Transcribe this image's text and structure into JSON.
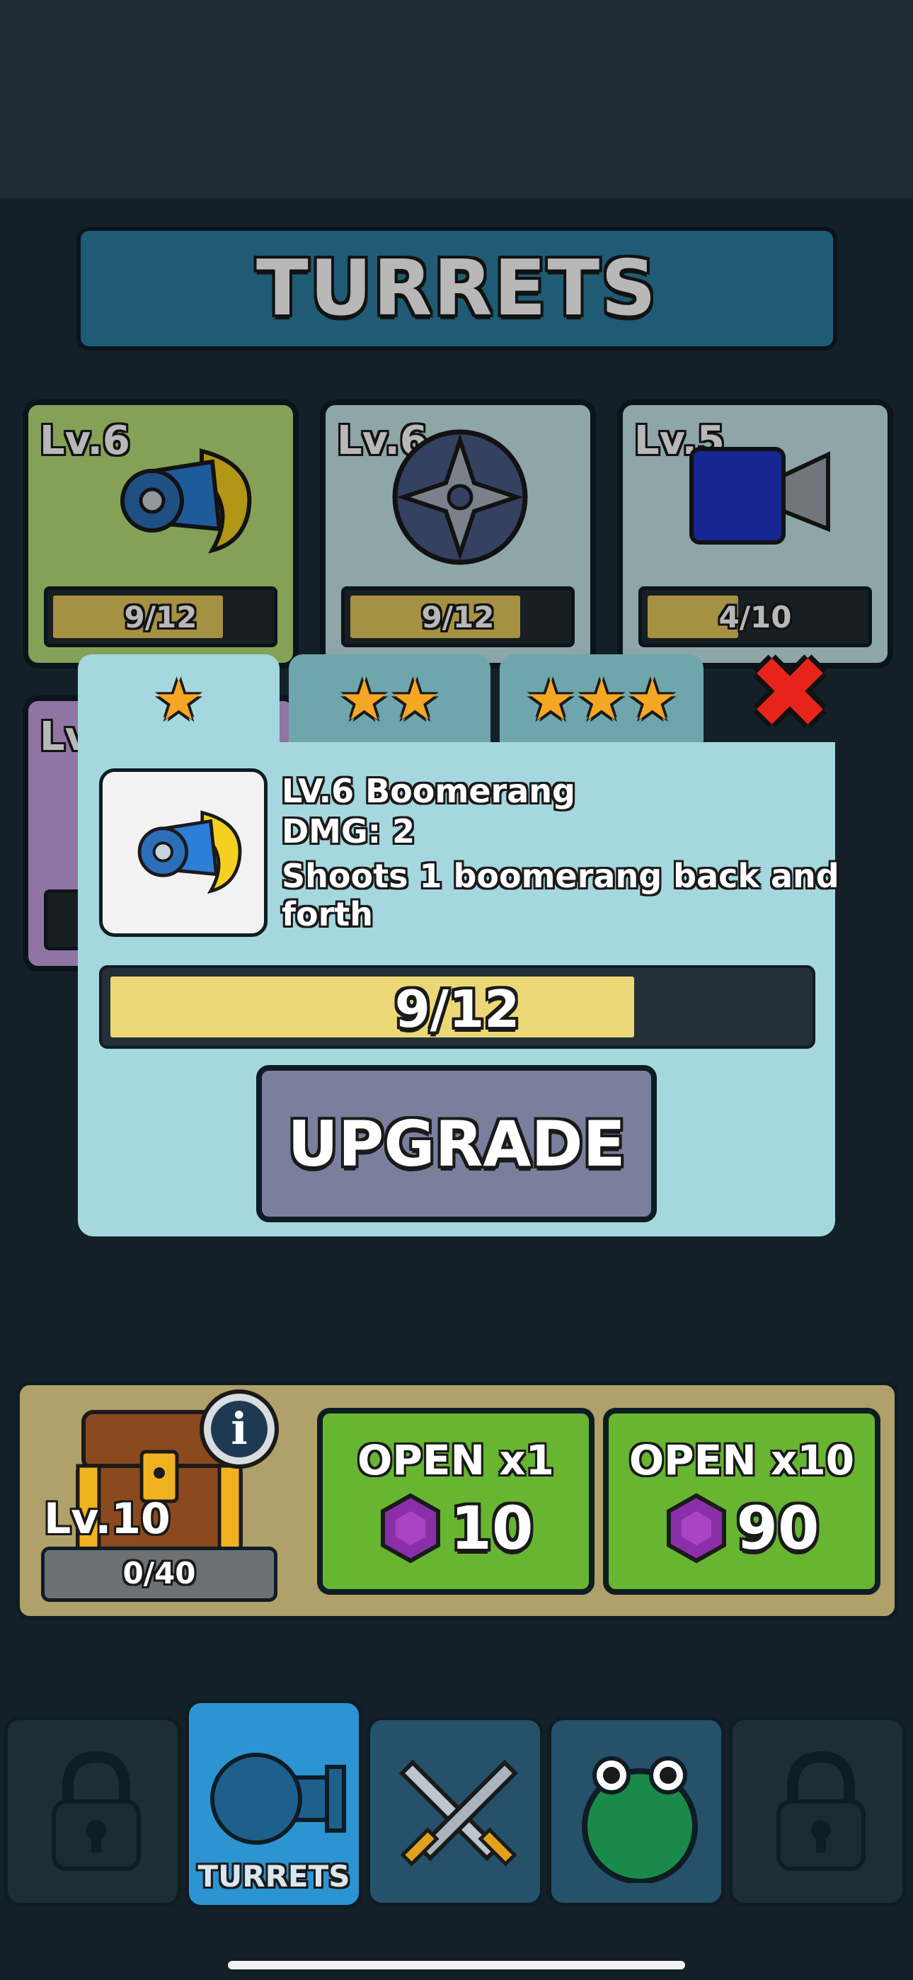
{
  "header": {
    "title": "TURRETS"
  },
  "turret_cards": [
    {
      "level": "Lv.6",
      "icon": "boomerang-turret-icon",
      "progress_text": "9/12",
      "progress": 0.75
    },
    {
      "level": "Lv.6",
      "icon": "shuriken-turret-icon",
      "progress_text": "9/12",
      "progress": 0.75
    },
    {
      "level": "Lv.5",
      "icon": "camera-turret-icon",
      "progress_text": "4/10",
      "progress": 0.4
    },
    {
      "level": "Lv",
      "icon": "hidden-turret-icon"
    }
  ],
  "popup": {
    "tabs": [
      {
        "stars": "★"
      },
      {
        "stars": "★★"
      },
      {
        "stars": "★★★"
      }
    ],
    "name": "LV.6 Boomerang",
    "dmg": "DMG: 2",
    "description": "Shoots 1 boomerang back and forth",
    "progress_text": "9/12",
    "progress": 0.75,
    "upgrade_label": "UPGRADE"
  },
  "chest": {
    "level": "Lv.10",
    "progress_text": "0/40",
    "progress": 0,
    "open1": {
      "label": "OPEN x1",
      "cost": "10"
    },
    "open10": {
      "label": "OPEN x10",
      "cost": "90"
    }
  },
  "nav": {
    "items": [
      {
        "label": "",
        "icon": "lock-icon"
      },
      {
        "label": "TURRETS",
        "icon": "turret-icon"
      },
      {
        "label": "",
        "icon": "crossed-swords-icon"
      },
      {
        "label": "",
        "icon": "frog-icon"
      },
      {
        "label": "",
        "icon": "lock-icon"
      }
    ]
  },
  "colors": {
    "background": "#1c2d38",
    "header": "#2c7ea3",
    "popup": "#a5d7de",
    "open_button": "#68b531",
    "upgrade_button": "#7b7f9e",
    "progress_fill": "#ecd777",
    "close": "#e8241a"
  }
}
